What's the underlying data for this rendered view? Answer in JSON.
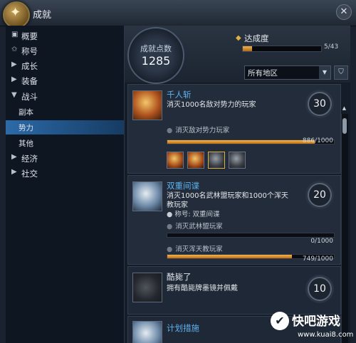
{
  "window": {
    "title": "成就",
    "close": "✕"
  },
  "sidebar": {
    "items": [
      {
        "icon": "▣",
        "label": "概要"
      },
      {
        "icon": "✩",
        "label": "称号"
      },
      {
        "icon": "▶",
        "label": "成长"
      },
      {
        "icon": "▶",
        "label": "装备"
      },
      {
        "icon": "▼",
        "label": "战斗"
      },
      {
        "label": "副本"
      },
      {
        "label": "势力"
      },
      {
        "label": "其他"
      },
      {
        "icon": "▶",
        "label": "经济"
      },
      {
        "icon": "▶",
        "label": "社交"
      }
    ],
    "selected": "势力"
  },
  "header": {
    "points_label": "成就点数",
    "points_value": "1285",
    "progress_label": "达成度",
    "progress_value": "5/43",
    "progress_fraction": 0.116,
    "region_select": "所有地区",
    "arrow": "▼",
    "filter": "⛉"
  },
  "achievements": [
    {
      "name": "千人斩",
      "desc": "消灭1000名敌对势力的玩家",
      "points": "30",
      "conditions": [
        {
          "label": "消灭敌对势力玩家",
          "value": "886/1000",
          "fraction": 0.886
        }
      ]
    },
    {
      "name": "双重间谍",
      "desc": "消灭1000名武林盟玩家和1000个浑天教玩家",
      "reward": "称号: 双重间谍",
      "points": "20",
      "conditions": [
        {
          "label": "消灭武林盟玩家",
          "value": "0/1000",
          "fraction": 0.0
        },
        {
          "label": "消灭浑天教玩家",
          "value": "749/1000",
          "fraction": 0.749
        }
      ]
    },
    {
      "name": "酷毙了",
      "desc": "拥有酷毙牌墨镜并佩戴",
      "points": "10"
    },
    {
      "name": "计划措施"
    }
  ],
  "watermark": {
    "text": "快吧游戏",
    "url": "www.kuai8.com",
    "glyph": "✔"
  }
}
